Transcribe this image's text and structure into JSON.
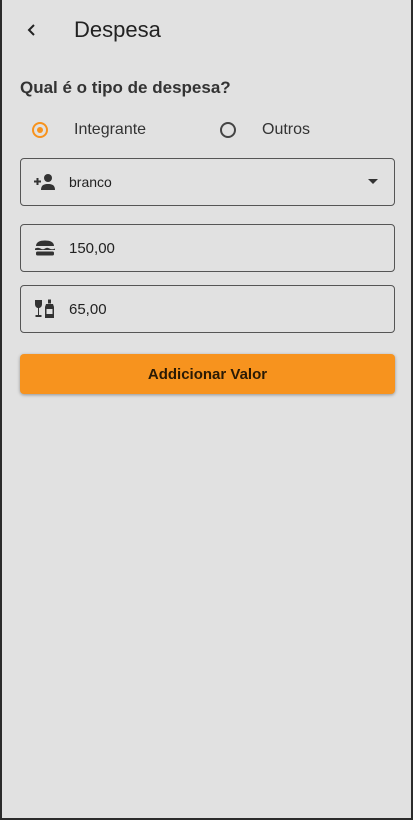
{
  "app_bar": {
    "title": "Despesa",
    "back_icon": "chevron-left-icon"
  },
  "form": {
    "question": "Qual é o tipo de despesa?",
    "radio_options": [
      {
        "label": "Integrante",
        "selected": true
      },
      {
        "label": "Outros",
        "selected": false
      }
    ],
    "member_select": {
      "icon": "person-add-icon",
      "value": "branco"
    },
    "food_field": {
      "icon": "burger-icon",
      "value": "150,00"
    },
    "drink_field": {
      "icon": "wine-bottle-icon",
      "value": "65,00"
    },
    "add_button_label": "Addicionar Valor"
  },
  "colors": {
    "accent": "#f7931e",
    "background": "#e1e1e1"
  }
}
